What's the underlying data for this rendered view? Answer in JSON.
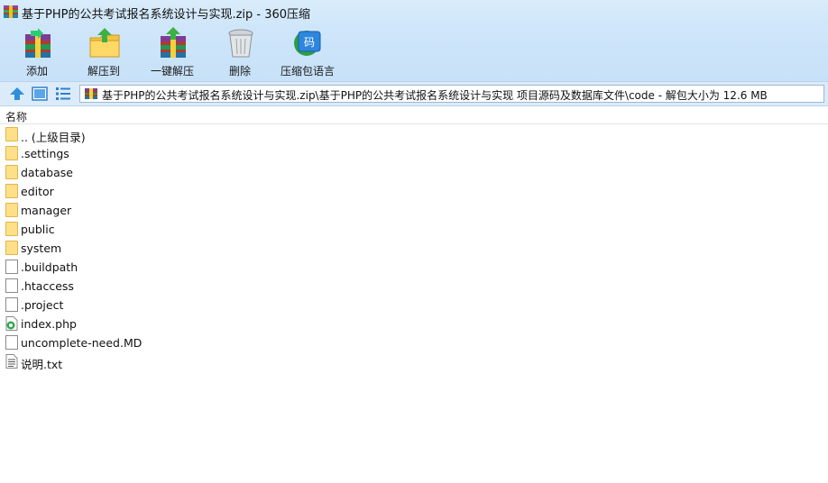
{
  "window": {
    "title": "基于PHP的公共考试报名系统设计与实现.zip - 360压缩"
  },
  "toolbar": {
    "buttons": [
      {
        "label": "添加",
        "icon": "add-icon"
      },
      {
        "label": "解压到",
        "icon": "extract-to-icon"
      },
      {
        "label": "一键解压",
        "icon": "one-click-extract-icon"
      },
      {
        "label": "删除",
        "icon": "delete-icon"
      },
      {
        "label": "压缩包语言",
        "icon": "archive-language-icon"
      }
    ]
  },
  "address": {
    "path": "基于PHP的公共考试报名系统设计与实现.zip\\基于PHP的公共考试报名系统设计与实现 项目源码及数据库文件\\code - 解包大小为 12.6 MB"
  },
  "list": {
    "column_name": "名称",
    "items": [
      {
        "name": ".. (上级目录)",
        "type": "folder"
      },
      {
        "name": ".settings",
        "type": "folder"
      },
      {
        "name": "database",
        "type": "folder"
      },
      {
        "name": "editor",
        "type": "folder"
      },
      {
        "name": "manager",
        "type": "folder"
      },
      {
        "name": "public",
        "type": "folder"
      },
      {
        "name": "system",
        "type": "folder"
      },
      {
        "name": ".buildpath",
        "type": "file"
      },
      {
        "name": ".htaccess",
        "type": "file"
      },
      {
        "name": ".project",
        "type": "file"
      },
      {
        "name": "index.php",
        "type": "php"
      },
      {
        "name": "uncomplete-need.MD",
        "type": "file"
      },
      {
        "name": "说明.txt",
        "type": "text"
      }
    ]
  },
  "colors": {
    "toolbar_bg": "#cfe6fa",
    "folder": "#ffe08a"
  }
}
